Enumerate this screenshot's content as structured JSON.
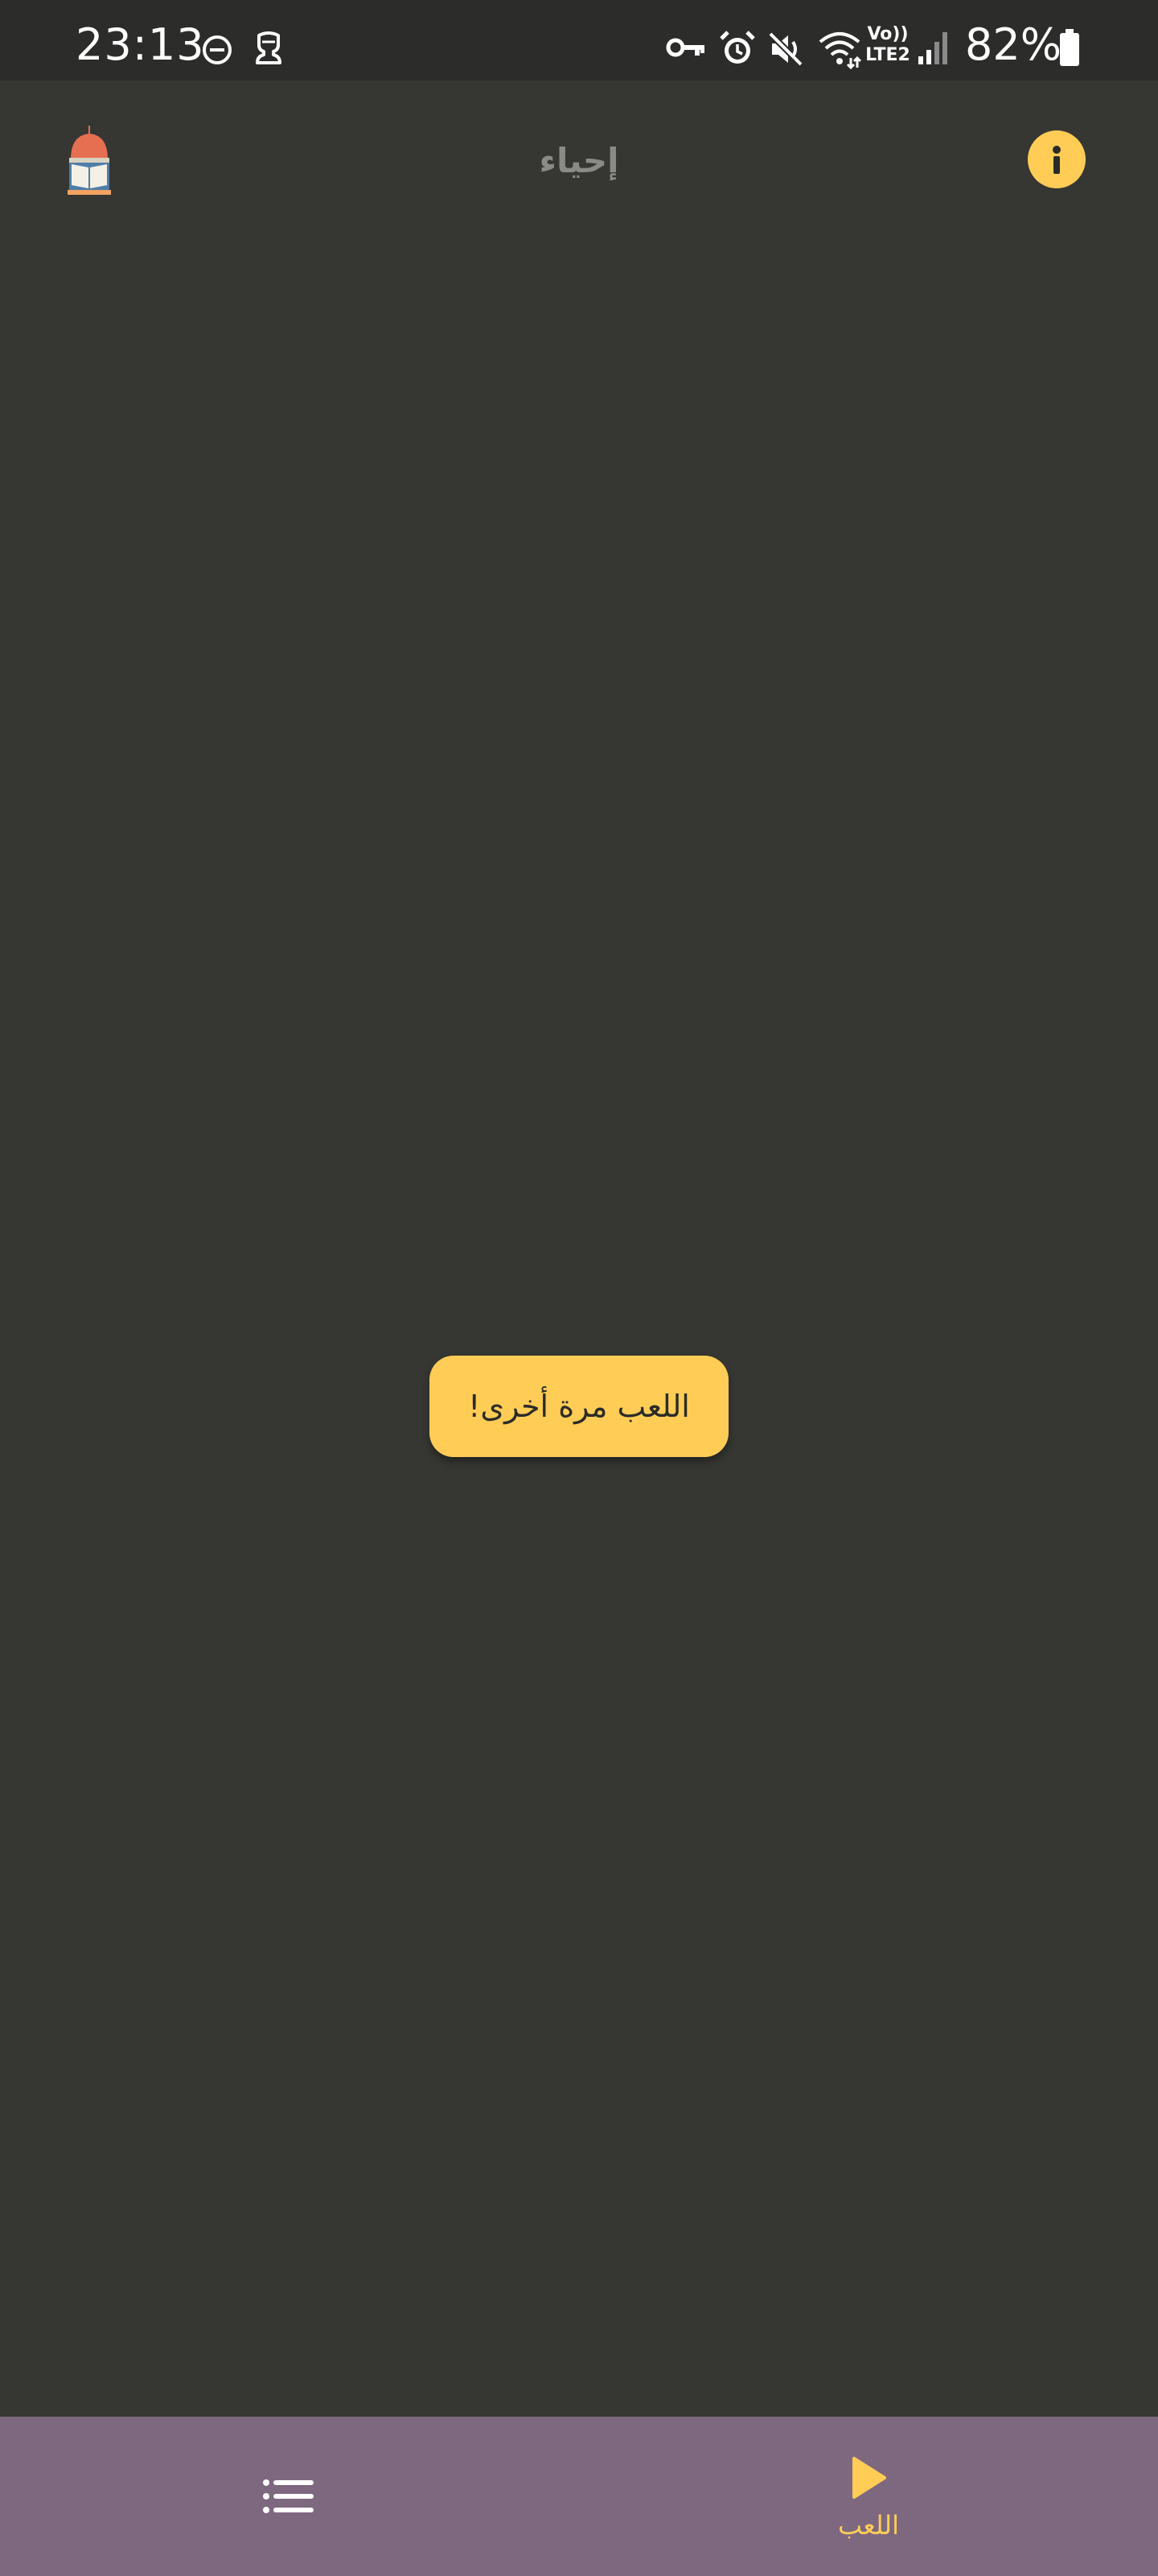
{
  "status_bar": {
    "time": "23:13",
    "network_label": "Vo))\nLTE2",
    "battery_percent": "82%",
    "icons": [
      "do-not-disturb-icon",
      "app-notification-icon",
      "vpn-key-icon",
      "alarm-icon",
      "mute-icon",
      "wifi-icon",
      "signal-icon",
      "battery-icon"
    ]
  },
  "app_bar": {
    "title": "إحياء",
    "logo_icon": "mosque-book-logo",
    "info_icon": "info-icon"
  },
  "main": {
    "play_again_label": "اللعب مرة أخرى!"
  },
  "bottom_nav": {
    "items": [
      {
        "icon": "list-icon",
        "label": ""
      },
      {
        "icon": "play-icon",
        "label": "اللعب"
      }
    ]
  },
  "colors": {
    "background": "#363632",
    "status_bar": "#2c2c2b",
    "accent": "#ffcd56",
    "nav_background": "#7e6880",
    "title_text": "#8a8a86"
  }
}
